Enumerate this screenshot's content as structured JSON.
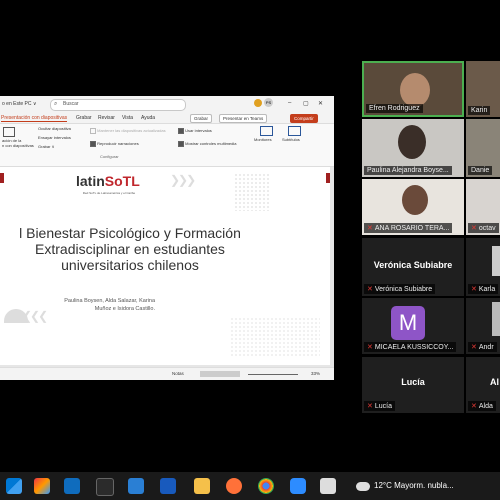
{
  "ppt": {
    "title_text": "o en Este PC ∨",
    "search_placeholder": "Buscar",
    "menu": [
      "Presentación con diapositivas",
      "Grabar",
      "Revisar",
      "Vista",
      "Ayuda"
    ],
    "actions": {
      "record": "Grabar",
      "teams": "Presentar en Teams",
      "share": "Compartir"
    },
    "ribbon": {
      "from_slides": "ación de la\nn con diapositivas",
      "hide_slide": "Ocultar diapositiva",
      "rehearse": "Ensayar intervalos",
      "record": "Grabar",
      "keep_updated": "Mantener las diapositivas actualizadas",
      "play_narrations": "Reproducir narraciones",
      "use_timings": "Usar intervalos",
      "show_media_controls": "Mostrar controles multimedia",
      "monitors": "Monitores",
      "subtitles": "Subtítulos",
      "group_configure": "Configurar"
    },
    "slide": {
      "logo_a": "latin",
      "logo_b": "SoTL",
      "logo_sub": "Red SoTL de Latinoamérica y el Caribe",
      "title": "l Bienestar Psicológico y Formación Extradisciplinar en estudiantes universitarios chilenos",
      "authors": "Paulina Boysen, Alda Salazar, Karina Muñoz e Isidora Castillo."
    },
    "status": {
      "notes": "Notas",
      "zoom": "33%"
    }
  },
  "participants": [
    {
      "name": "Efren Rodriguez",
      "video": true
    },
    {
      "name": "Karin",
      "video": true
    },
    {
      "name": "Paulina Alejandra Boyse...",
      "video": true
    },
    {
      "name": "Danie",
      "video": true
    },
    {
      "name": "ANA ROSARIO TERA...",
      "video": true
    },
    {
      "name": "octav",
      "video": true
    },
    {
      "name": "Verónica Subiabre",
      "label": "Verónica Subiabre",
      "video": false
    },
    {
      "name": "Karla",
      "video": false
    },
    {
      "name": "MICAELA KUSSICCOY...",
      "avatar": "M",
      "video": false
    },
    {
      "name": "Andr",
      "video": false
    },
    {
      "name": "Lucía",
      "label": "Lucía",
      "video": false
    },
    {
      "name": "Alda",
      "label": "Al",
      "video": false
    }
  ],
  "taskbar": {
    "temperature": "12°C",
    "weather": "Mayorm. nubla..."
  },
  "colors": {
    "accent": "#c43e1c",
    "zoom_avatar": "#8e55c7",
    "speaker_border": "#4caf50"
  }
}
